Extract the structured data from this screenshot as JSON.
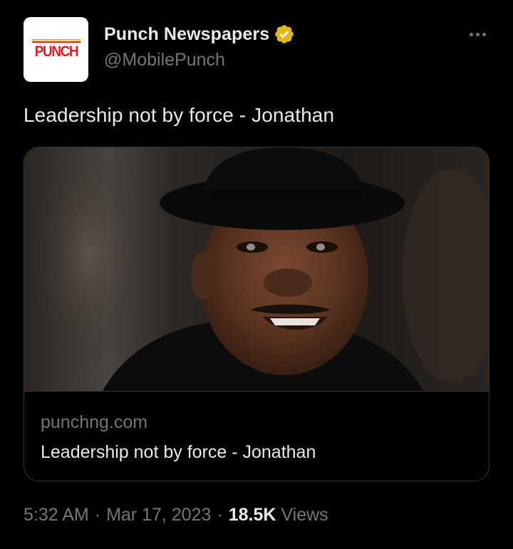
{
  "author": {
    "display_name": "Punch Newspapers",
    "handle": "@MobilePunch",
    "avatar_text": "PUNCH",
    "avatar_icon": "punch-logo-icon",
    "verified_icon": "verified-badge-icon",
    "verified_color": "#e2b719"
  },
  "header": {
    "more_icon": "more-options-icon"
  },
  "tweet": {
    "text": "Leadership not by force - Jonathan"
  },
  "link_card": {
    "image_icon": "article-photo",
    "domain": "punchng.com",
    "title": "Leadership not by force - Jonathan"
  },
  "meta": {
    "time": "5:32 AM",
    "separator": "·",
    "date": "Mar 17, 2023",
    "views_count": "18.5K",
    "views_label": "Views"
  },
  "colors": {
    "background": "#000000",
    "primary_text": "#e7e9ea",
    "secondary_text": "#71767b",
    "border": "#2f3336",
    "brand_red": "#d41f26"
  }
}
